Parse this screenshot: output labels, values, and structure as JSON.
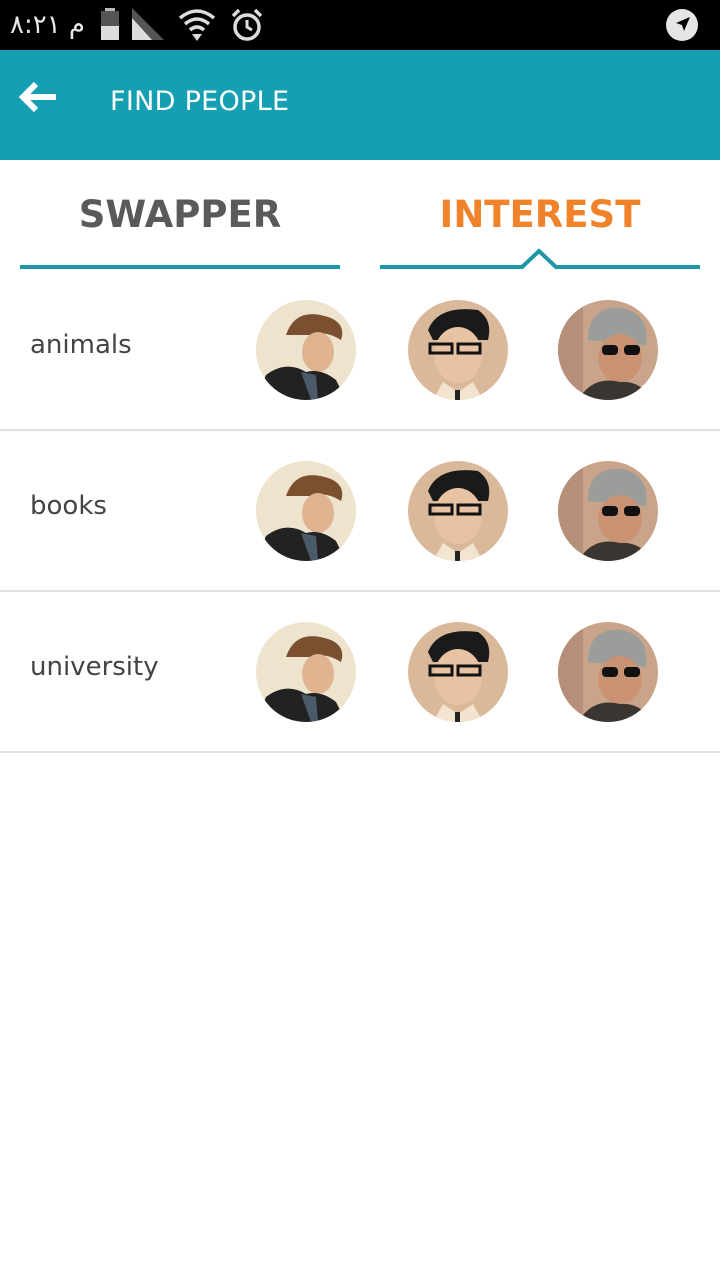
{
  "status_bar": {
    "time": "م ٨:٢١",
    "icons": [
      "battery-icon",
      "signal-icon",
      "wifi-icon",
      "alarm-icon",
      "location-icon"
    ]
  },
  "app_bar": {
    "back_icon": "arrow-left-icon",
    "title": "FIND PEOPLE",
    "color": "#149fb3"
  },
  "tabs": [
    {
      "label": "SWAPPER",
      "active": false,
      "color": "#5a5a5a"
    },
    {
      "label": "INTEREST",
      "active": true,
      "color": "#f0822a"
    }
  ],
  "interests": [
    {
      "name": "animals",
      "avatars": [
        "avatar-man-swept-hair",
        "avatar-man-glasses",
        "avatar-man-beanie-sunglasses"
      ]
    },
    {
      "name": "books",
      "avatars": [
        "avatar-man-swept-hair",
        "avatar-man-glasses",
        "avatar-man-beanie-sunglasses"
      ]
    },
    {
      "name": "university",
      "avatars": [
        "avatar-man-swept-hair",
        "avatar-man-glasses",
        "avatar-man-beanie-sunglasses"
      ]
    }
  ],
  "colors": {
    "underline": "#1d97a6",
    "divider": "#e1e1e1"
  }
}
